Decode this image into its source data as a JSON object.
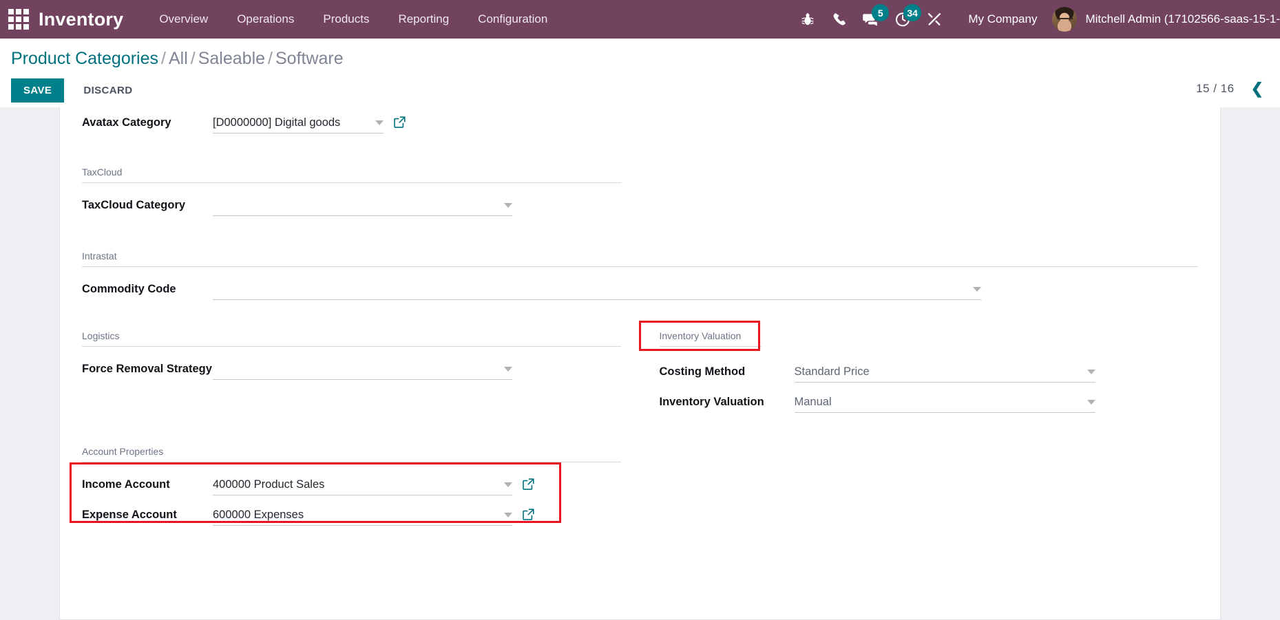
{
  "navbar": {
    "apps_icon": "apps-grid-icon",
    "brand": "Inventory",
    "menu": [
      {
        "label": "Overview"
      },
      {
        "label": "Operations"
      },
      {
        "label": "Products"
      },
      {
        "label": "Reporting"
      },
      {
        "label": "Configuration"
      }
    ],
    "icons": [
      {
        "name": "bug-icon",
        "badge": ""
      },
      {
        "name": "phone-icon",
        "badge": ""
      },
      {
        "name": "messages-icon",
        "badge": "5"
      },
      {
        "name": "activities-clock-icon",
        "badge": "34"
      },
      {
        "name": "tools-icon",
        "badge": ""
      }
    ],
    "company": "My Company",
    "user": "Mitchell Admin (17102566-saas-15-1-",
    "badge_color": "#00808a",
    "bg_color": "#71435f"
  },
  "control_panel": {
    "breadcrumb": {
      "root": "Product Categories",
      "sep": "/",
      "parts": [
        "All",
        "Saleable"
      ],
      "current": "Software"
    },
    "save_label": "SAVE",
    "discard_label": "DISCARD",
    "pager": {
      "count": "15 / 16",
      "prev_icon": "chevron-left-icon"
    }
  },
  "form": {
    "avatax": {
      "label": "Avatax Category",
      "value": "[D0000000] Digital goods",
      "has_external_link": true
    },
    "taxcloud": {
      "title": "TaxCloud",
      "category_label": "TaxCloud Category",
      "category_value": ""
    },
    "intrastat": {
      "title": "Intrastat",
      "commodity_label": "Commodity Code",
      "commodity_value": ""
    },
    "logistics": {
      "title": "Logistics",
      "removal_label": "Force Removal Strategy",
      "removal_value": ""
    },
    "inventory_valuation": {
      "title": "Inventory Valuation",
      "costing_label": "Costing Method",
      "costing_value": "Standard Price",
      "valuation_label": "Inventory Valuation",
      "valuation_value": "Manual",
      "highlight_color": "#e8141f"
    },
    "account_properties": {
      "title": "Account Properties",
      "income_label": "Income Account",
      "income_value": "400000 Product Sales",
      "expense_label": "Expense Account",
      "expense_value": "600000 Expenses",
      "highlight_color": "#e8141f"
    }
  }
}
